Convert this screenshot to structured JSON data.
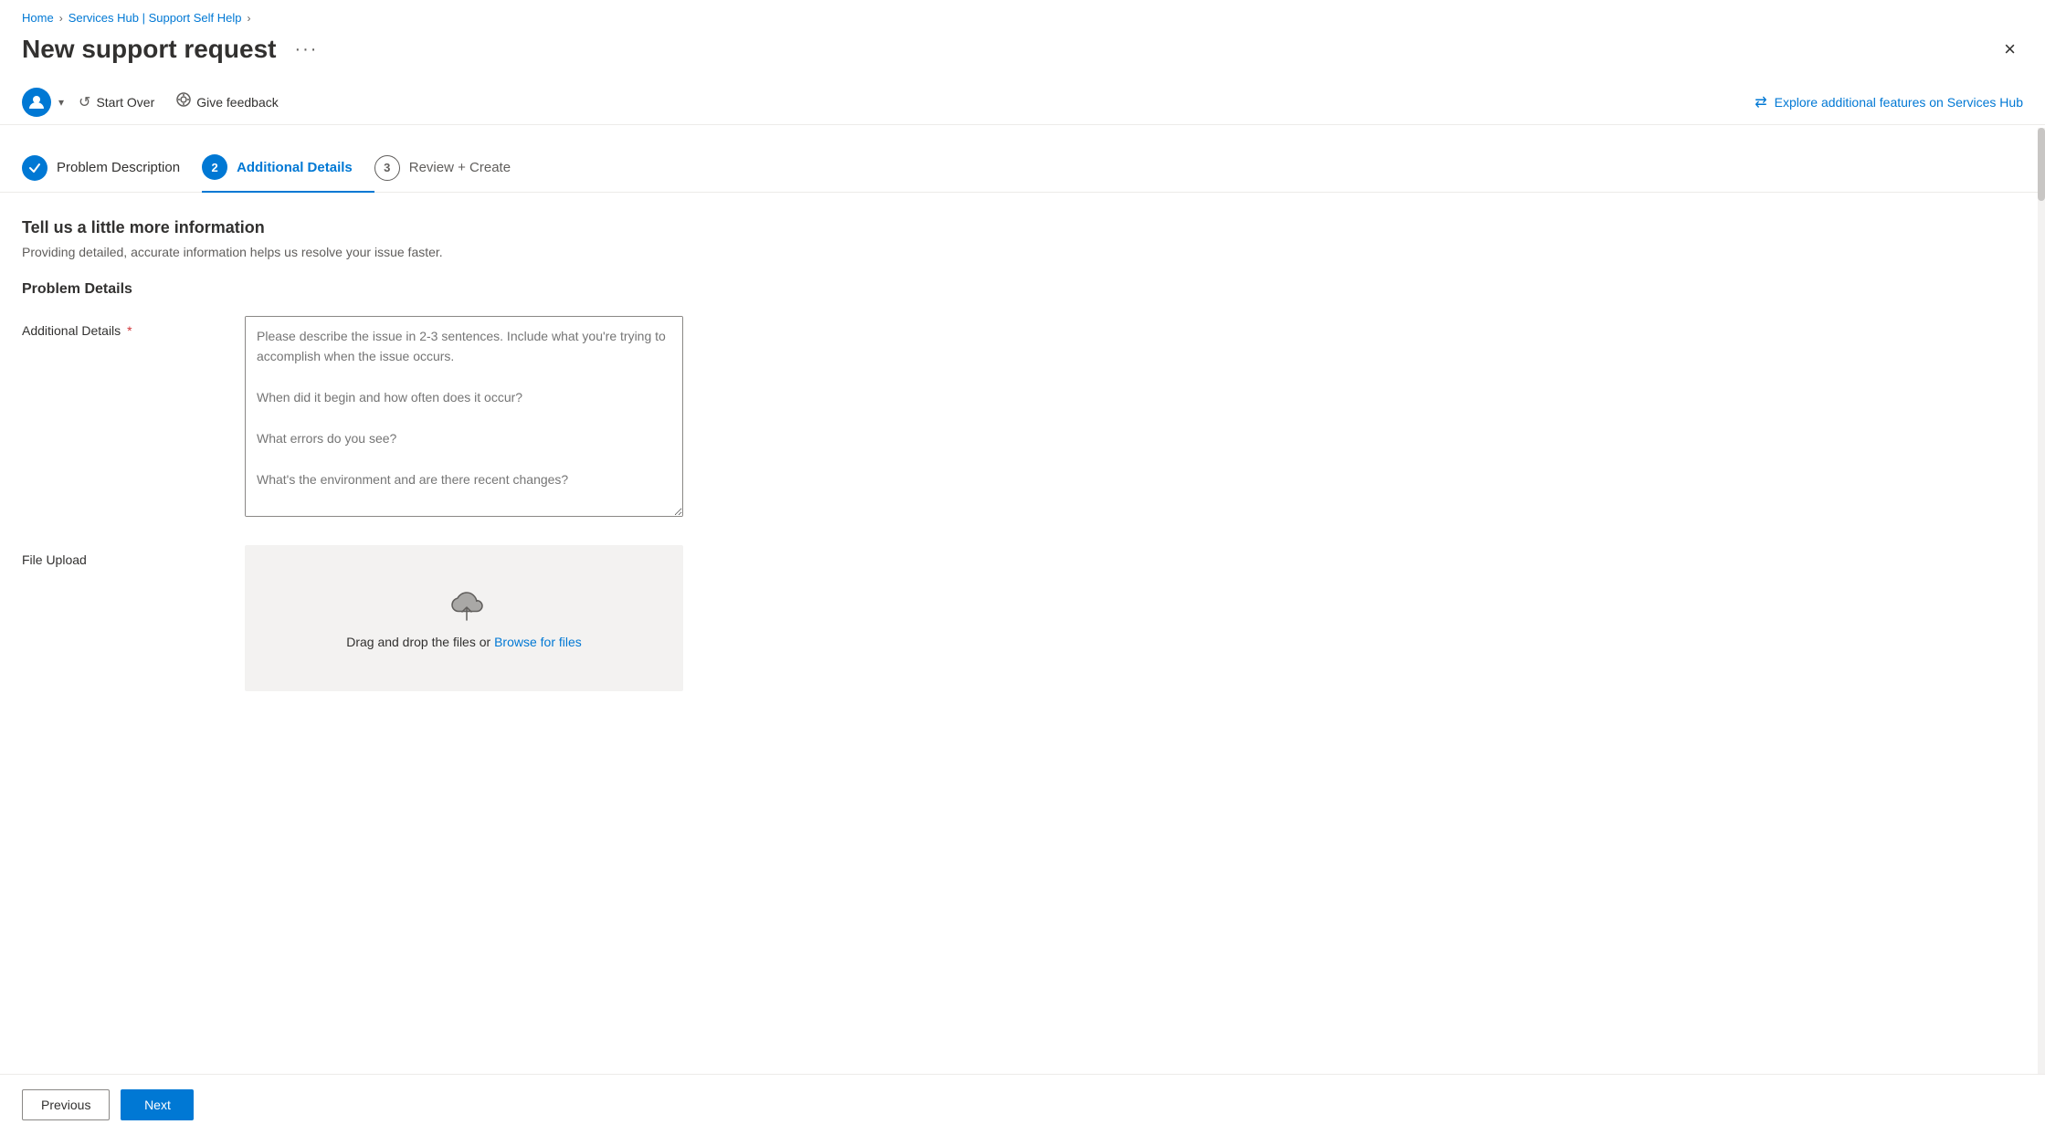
{
  "breadcrumb": {
    "items": [
      {
        "label": "Home",
        "href": "#"
      },
      {
        "label": "Services Hub | Support Self Help",
        "href": "#"
      }
    ]
  },
  "header": {
    "title": "New support request",
    "more_options_label": "···",
    "close_label": "×"
  },
  "toolbar": {
    "start_over_label": "Start Over",
    "give_feedback_label": "Give feedback",
    "explore_label": "Explore additional features on Services Hub"
  },
  "stepper": {
    "steps": [
      {
        "number": "✓",
        "label": "Problem Description",
        "state": "completed"
      },
      {
        "number": "2",
        "label": "Additional Details",
        "state": "active"
      },
      {
        "number": "3",
        "label": "Review + Create",
        "state": "inactive"
      }
    ]
  },
  "form": {
    "section_title": "Tell us a little more information",
    "section_subtitle": "Providing detailed, accurate information helps us resolve your issue faster.",
    "problem_details_title": "Problem Details",
    "additional_details_label": "Additional Details",
    "additional_details_required": true,
    "additional_details_placeholder": "Please describe the issue in 2-3 sentences. Include what you're trying to accomplish when the issue occurs.\n\nWhen did it begin and how often does it occur?\n\nWhat errors do you see?\n\nWhat's the environment and are there recent changes?\n\nWhat have you tried to troubleshoot this?",
    "file_upload_label": "File Upload",
    "file_upload_text": "Drag and drop the files or ",
    "file_upload_link_text": "Browse for files"
  },
  "navigation": {
    "previous_label": "Previous",
    "next_label": "Next"
  }
}
